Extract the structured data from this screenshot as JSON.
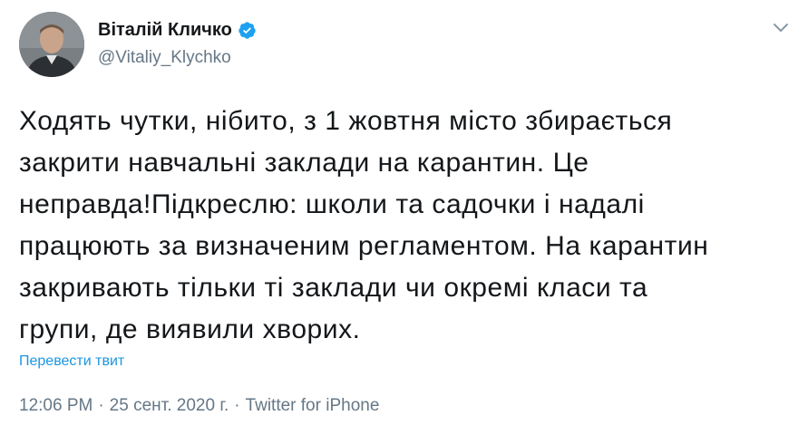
{
  "author": {
    "name": "Віталій Кличко",
    "handle": "@Vitaliy_Klychko",
    "verified": true
  },
  "tweet": {
    "lines": [
      "Ходять чутки, нібито, з 1 жовтня місто збирається",
      "закрити навчальні заклади на карантин. Це",
      "неправда!Підкреслю: школи та садочки і надалі",
      "працюють за визначеним регламентом. На карантин",
      "закривають тільки ті заклади чи окремі класи та",
      "групи, де виявили хворих."
    ],
    "translate_label": "Перевести твит"
  },
  "meta": {
    "time": "12:06 PM",
    "separator": "·",
    "date": "25 сент. 2020 г.",
    "source": "Twitter for iPhone"
  },
  "icons": {
    "verified": "verified-badge-icon",
    "menu": "chevron-down-icon"
  },
  "colors": {
    "text": "#14171a",
    "secondary": "#657786",
    "link": "#1b95e0",
    "verified": "#1da1f2"
  }
}
